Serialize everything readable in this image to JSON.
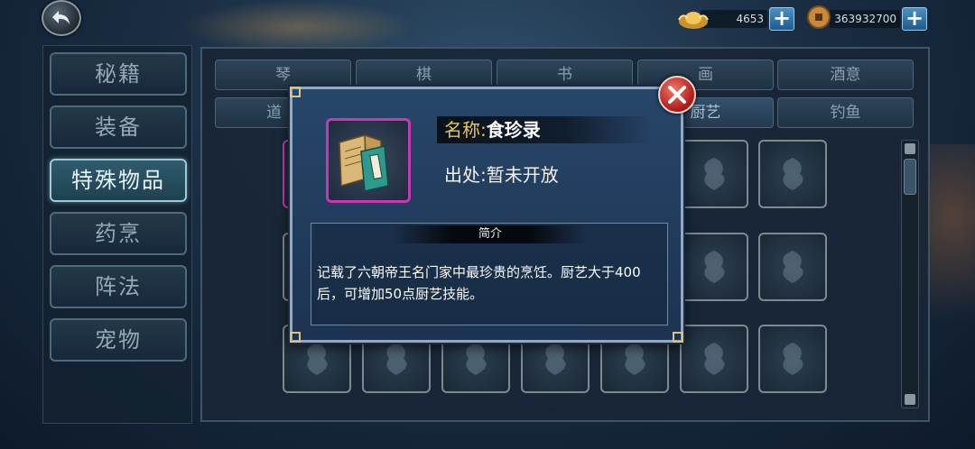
{
  "currency": {
    "gold_icon": "gold-ingot-icon",
    "gold_amount": "4653",
    "coin_icon": "copper-coin-icon",
    "coin_amount": "363932700",
    "plus_label": "+"
  },
  "left_nav": {
    "items": [
      {
        "label": "秘籍",
        "active": false
      },
      {
        "label": "装备",
        "active": false
      },
      {
        "label": "特殊物品",
        "active": true
      },
      {
        "label": "药烹",
        "active": false
      },
      {
        "label": "阵法",
        "active": false
      },
      {
        "label": "宠物",
        "active": false
      }
    ]
  },
  "tabs": {
    "row1": [
      "琴",
      "棋",
      "书",
      "画",
      "酒意"
    ],
    "row2": [
      "道",
      "厨艺",
      "钓鱼"
    ]
  },
  "popup": {
    "item_icon": "recipe-book-icon",
    "name_label": "名称:",
    "name_value": "食珍录",
    "source_label": "出处:",
    "source_value": "暂未开放",
    "desc_header": "简介",
    "description": "记载了六朝帝王名门家中最珍贵的烹饪。厨艺大于400后，可增加50点厨艺技能。"
  },
  "colors": {
    "accent_gold": "#e6c460",
    "rarity_frame": "#c53ab3",
    "close_red": "#b21e1e"
  }
}
